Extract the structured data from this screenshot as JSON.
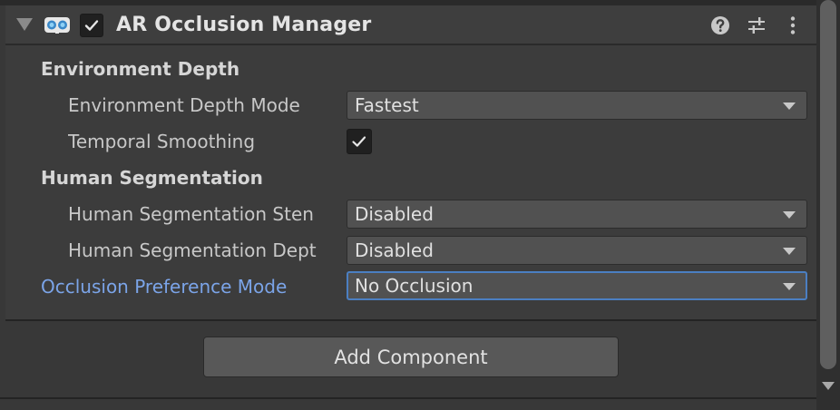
{
  "component": {
    "title": "AR Occlusion Manager",
    "enabled": true,
    "icon": "ar-goggles-icon",
    "header_buttons": [
      "help-icon",
      "presets-icon",
      "kebab-menu-icon"
    ]
  },
  "sections": {
    "environment_depth": {
      "label": "Environment Depth",
      "depth_mode_label": "Environment Depth Mode",
      "depth_mode_value": "Fastest",
      "temporal_smoothing_label": "Temporal Smoothing",
      "temporal_smoothing_checked": true
    },
    "human_segmentation": {
      "label": "Human Segmentation",
      "stencil_label": "Human Segmentation Sten",
      "stencil_value": "Disabled",
      "depth_label": "Human Segmentation Dept",
      "depth_value": "Disabled"
    }
  },
  "occlusion_preference": {
    "label": "Occlusion Preference Mode",
    "value": "No Occlusion"
  },
  "add_component_label": "Add Component",
  "colors": {
    "background": "#383838",
    "field": "#515151",
    "focus_accent": "#4b7fc2",
    "active_label": "#7ba4e8",
    "checkbox": "#202020"
  }
}
